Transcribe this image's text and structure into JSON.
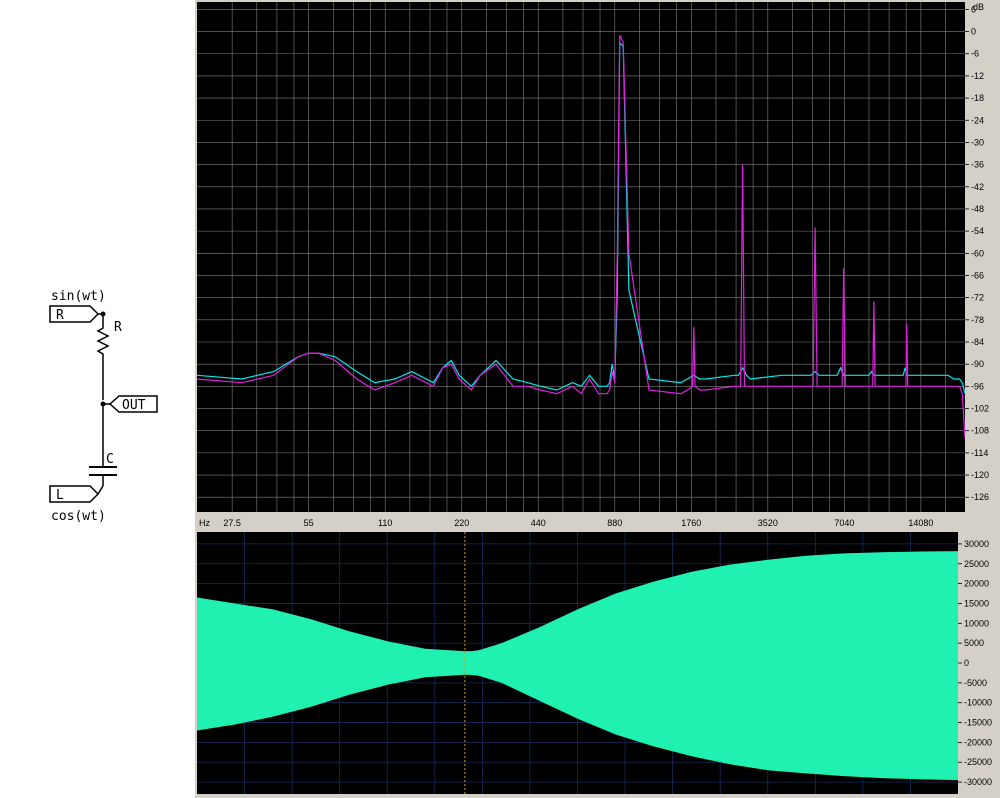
{
  "schematic": {
    "top_source_label": "sin(wt)",
    "bottom_source_label": "cos(wt)",
    "input_r_label": "R",
    "input_l_label": "L",
    "resistor_label": "R",
    "capacitor_label": "C",
    "output_label": "OUT"
  },
  "spectrum": {
    "unit_label": "dB",
    "hz_label": "Hz",
    "y_ticks": [
      "6",
      "0",
      "-6",
      "-12",
      "-18",
      "-24",
      "-30",
      "-36",
      "-42",
      "-48",
      "-54",
      "-60",
      "-66",
      "-72",
      "-78",
      "-84",
      "-90",
      "-96",
      "-102",
      "-108",
      "-114",
      "-120",
      "-126"
    ],
    "x_ticks": [
      "27.5",
      "55",
      "110",
      "220",
      "440",
      "880",
      "1760",
      "3520",
      "7040",
      "14080"
    ],
    "colors": {
      "background": "#000000",
      "grid": "#808080",
      "input": "#00e8e8",
      "output": "#e020e0"
    }
  },
  "chart_data": [
    {
      "type": "line",
      "xscale": "log",
      "xlabel": "Hz",
      "ylabel": "dB",
      "ylim": [
        -130,
        8
      ],
      "series": [
        {
          "x": [
            20,
            30,
            40,
            50,
            55,
            60,
            70,
            85,
            100,
            120,
            140,
            170,
            185,
            200,
            215,
            240,
            260,
            300,
            350,
            400,
            450,
            520,
            600,
            650,
            700,
            760,
            820,
            840,
            860,
            880,
            900,
            920,
            950,
            1000,
            1200,
            1600,
            1700,
            1800,
            1900,
            2000,
            2600,
            2700,
            2800,
            2900,
            3000,
            4000,
            5000,
            5200,
            5400,
            5600,
            6000,
            6400,
            6600,
            6800,
            7000,
            8000,
            8800,
            9000,
            9200,
            10000,
            11000,
            12000,
            12200,
            12400,
            14000,
            16000,
            18000,
            19000,
            20000,
            20500,
            21000
          ],
          "y": [
            -93,
            -94,
            -92,
            -88,
            -87,
            -87,
            -88,
            -92,
            -95,
            -94,
            -92,
            -95,
            -91,
            -89,
            -93,
            -96,
            -93,
            -89,
            -94,
            -95,
            -96,
            -97,
            -95,
            -96,
            -93,
            -96,
            -96,
            -95,
            -90,
            -94,
            -70,
            -3,
            -4,
            -70,
            -94,
            -95,
            -94,
            -93,
            -94,
            -94,
            -93,
            -93,
            -91,
            -93,
            -94,
            -93,
            -93,
            -93,
            -92,
            -93,
            -93,
            -93,
            -93,
            -91,
            -93,
            -93,
            -93,
            -92,
            -93,
            -93,
            -93,
            -93,
            -91,
            -93,
            -93,
            -93,
            -93,
            -94,
            -94,
            -95,
            -98
          ]
        },
        {
          "x": [
            20,
            30,
            40,
            50,
            55,
            60,
            70,
            85,
            100,
            120,
            140,
            170,
            185,
            200,
            215,
            240,
            260,
            300,
            350,
            400,
            450,
            520,
            600,
            650,
            700,
            760,
            820,
            840,
            860,
            880,
            900,
            920,
            950,
            1000,
            1200,
            1600,
            1700,
            1780,
            1800,
            1820,
            1900,
            2000,
            2600,
            2750,
            2800,
            2850,
            3000,
            4000,
            5000,
            5300,
            5400,
            5500,
            6000,
            6400,
            6800,
            6900,
            7000,
            7100,
            8000,
            8800,
            9100,
            9200,
            9300,
            10000,
            11000,
            12000,
            12300,
            12400,
            12500,
            14000,
            16000,
            18000,
            19000,
            20000,
            20500,
            21000
          ],
          "y": [
            -94,
            -95,
            -93,
            -88,
            -87,
            -87,
            -89,
            -94,
            -97,
            -95,
            -93,
            -96,
            -91,
            -90,
            -94,
            -97,
            -93,
            -90,
            -96,
            -96,
            -97,
            -98,
            -96,
            -98,
            -94,
            -98,
            -98,
            -97,
            -92,
            -95,
            -60,
            -1,
            -3,
            -60,
            -97,
            -98,
            -97,
            -96,
            -80,
            -96,
            -97,
            -97,
            -96,
            -96,
            -36,
            -96,
            -96,
            -96,
            -96,
            -96,
            -53,
            -96,
            -96,
            -96,
            -96,
            -96,
            -64,
            -96,
            -96,
            -96,
            -96,
            -73,
            -96,
            -96,
            -96,
            -96,
            -96,
            -79,
            -96,
            -96,
            -96,
            -96,
            -96,
            -96,
            -98,
            -110
          ]
        }
      ]
    },
    {
      "type": "area",
      "ylim": [
        -33000,
        33000
      ],
      "y_ticks": [
        "30000",
        "25000",
        "20000",
        "15000",
        "10000",
        "5000",
        "0",
        "-5000",
        "-10000",
        "-15000",
        "-20000",
        "-25000",
        "-30000"
      ],
      "series": [
        {
          "x": [
            0,
            0.05,
            0.1,
            0.15,
            0.2,
            0.25,
            0.3,
            0.35,
            0.36,
            0.37,
            0.4,
            0.45,
            0.5,
            0.55,
            0.6,
            0.65,
            0.7,
            0.75,
            0.8,
            0.85,
            0.9,
            0.95,
            1.0
          ],
          "upper": [
            16500,
            15000,
            13500,
            11000,
            8000,
            5500,
            3600,
            3000,
            3000,
            3200,
            5000,
            9000,
            13500,
            17500,
            20500,
            23000,
            24800,
            26000,
            27000,
            27600,
            27900,
            28100,
            28200
          ],
          "lower": [
            -17000,
            -15500,
            -13500,
            -11000,
            -8000,
            -5500,
            -3600,
            -3000,
            -3000,
            -3200,
            -5000,
            -9500,
            -14000,
            -18000,
            -21000,
            -23500,
            -25500,
            -27000,
            -27800,
            -28500,
            -29000,
            -29300,
            -29500
          ]
        }
      ],
      "cursor_x": 0.352,
      "colors": {
        "background": "#000000",
        "grid": "#1a2a5a",
        "fill": "#20f0b0",
        "cursor": "#c8a020"
      }
    }
  ]
}
